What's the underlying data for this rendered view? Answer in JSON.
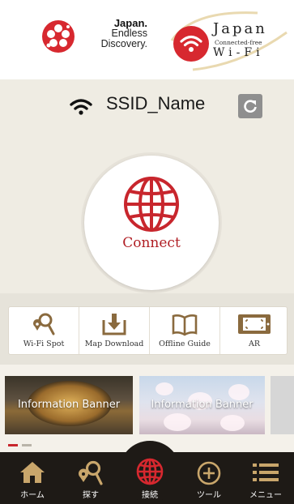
{
  "header": {
    "jnto_logo": {
      "line1": "Japan.",
      "line2": "Endless",
      "line3": "Discovery."
    },
    "wifi_logo": {
      "line1": "Japan",
      "line2": "Connected-free",
      "line3": "Wi-Fi"
    }
  },
  "connection": {
    "ssid": "SSID_Name",
    "connect_label": "Connect"
  },
  "tools": [
    {
      "label": "Wi-Fi Spot",
      "icon": "wifi-spot-icon"
    },
    {
      "label": "Map Download",
      "icon": "download-icon"
    },
    {
      "label": "Offline Guide",
      "icon": "book-icon"
    },
    {
      "label": "AR",
      "icon": "ar-icon"
    }
  ],
  "banners": [
    {
      "label": "Information Banner"
    },
    {
      "label": "Information Banner"
    }
  ],
  "nav": [
    {
      "label": "ホーム",
      "icon": "home-icon"
    },
    {
      "label": "探す",
      "icon": "search-icon"
    },
    {
      "label": "接続",
      "icon": "globe-icon"
    },
    {
      "label": "ツール",
      "icon": "plus-circle-icon"
    },
    {
      "label": "メニュー",
      "icon": "menu-icon"
    }
  ],
  "colors": {
    "accent_red": "#c8262d",
    "nav_bg": "#1e1a16",
    "background": "#efece3"
  }
}
